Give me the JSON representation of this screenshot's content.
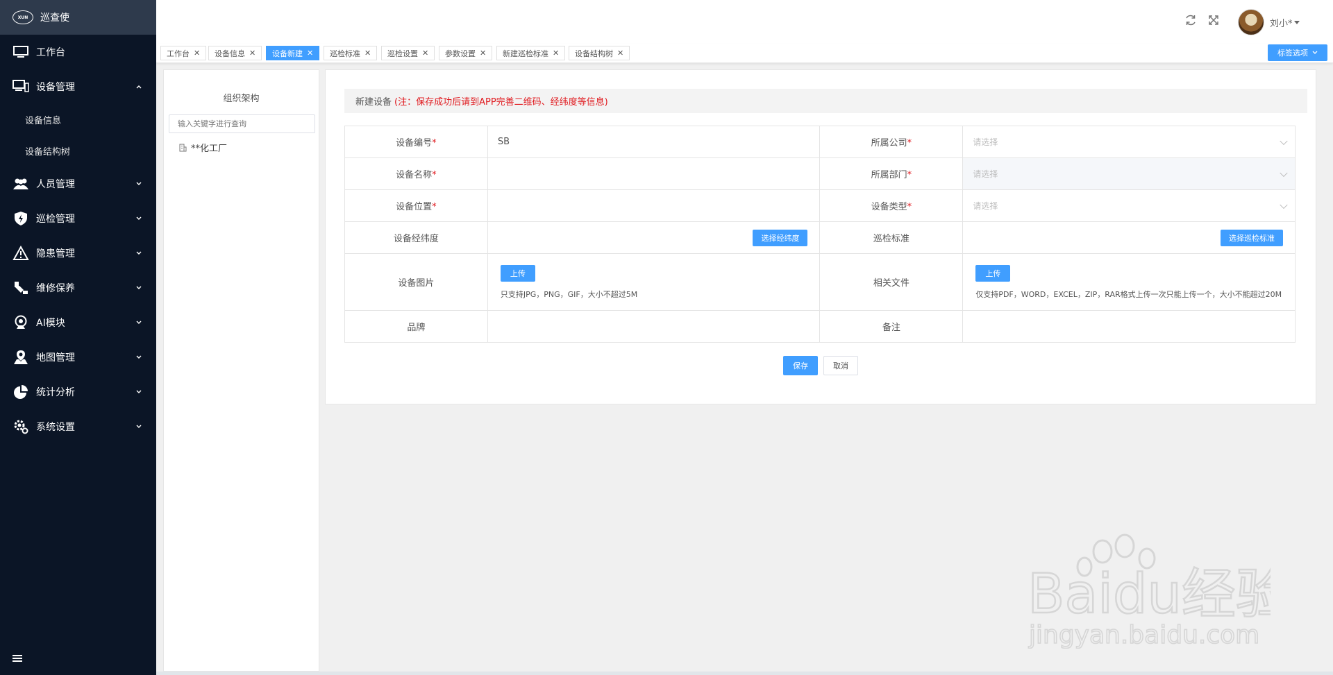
{
  "brand": {
    "name": "巡查使",
    "logo_text": "XUN"
  },
  "sidebar": {
    "items": [
      {
        "label": "工作台",
        "icon": "monitor-icon"
      },
      {
        "label": "设备管理",
        "icon": "devices-icon",
        "expanded": true,
        "children": [
          {
            "label": "设备信息"
          },
          {
            "label": "设备结构树"
          }
        ]
      },
      {
        "label": "人员管理",
        "icon": "users-icon"
      },
      {
        "label": "巡检管理",
        "icon": "shield-icon"
      },
      {
        "label": "隐患管理",
        "icon": "warning-icon"
      },
      {
        "label": "维修保养",
        "icon": "maintenance-icon"
      },
      {
        "label": "AI模块",
        "icon": "ai-camera-icon"
      },
      {
        "label": "地图管理",
        "icon": "map-pin-icon"
      },
      {
        "label": "统计分析",
        "icon": "pie-chart-icon"
      },
      {
        "label": "系统设置",
        "icon": "gear-icon"
      }
    ]
  },
  "header": {
    "user_name": "刘小*",
    "icons": [
      "refresh-icon",
      "fullscreen-icon"
    ]
  },
  "tabs": [
    {
      "label": "工作台",
      "active": false
    },
    {
      "label": "设备信息",
      "active": false
    },
    {
      "label": "设备新建",
      "active": true
    },
    {
      "label": "巡检标准",
      "active": false
    },
    {
      "label": "巡检设置",
      "active": false
    },
    {
      "label": "参数设置",
      "active": false
    },
    {
      "label": "新建巡检标准",
      "active": false
    },
    {
      "label": "设备结构树",
      "active": false
    }
  ],
  "tab_options_label": "标签选项",
  "org": {
    "title": "组织架构",
    "search_placeholder": "输入关键字进行查询",
    "node": "**化工厂"
  },
  "form": {
    "title": "新建设备",
    "note": "(注：保存成功后请到APP完善二维码、经纬度等信息)",
    "device_code_label": "设备编号",
    "device_code_value": "SB",
    "company_label": "所属公司",
    "company_placeholder": "请选择",
    "device_name_label": "设备名称",
    "department_label": "所属部门",
    "department_placeholder": "请选择",
    "location_label": "设备位置",
    "type_label": "设备类型",
    "type_placeholder": "请选择",
    "coords_label": "设备经纬度",
    "coords_button": "选择经纬度",
    "standard_label": "巡检标准",
    "standard_button": "选择巡检标准",
    "image_label": "设备图片",
    "image_upload": "上传",
    "image_hint": "只支持JPG，PNG，GIF，大小不超过5M",
    "files_label": "相关文件",
    "files_upload": "上传",
    "files_hint": "仅支持PDF，WORD，EXCEL，ZIP，RAR格式上传一次只能上传一个，大小不能超过20M",
    "brand_label": "品牌",
    "remark_label": "备注",
    "required_mark": "*",
    "save": "保存",
    "cancel": "取消"
  },
  "watermark": {
    "line1": "Baidu经验",
    "line2": "jingyan.baidu.com"
  },
  "colors": {
    "sidebar_bg": "#0b1526",
    "primary": "#409eff",
    "required": "#e0191e"
  }
}
